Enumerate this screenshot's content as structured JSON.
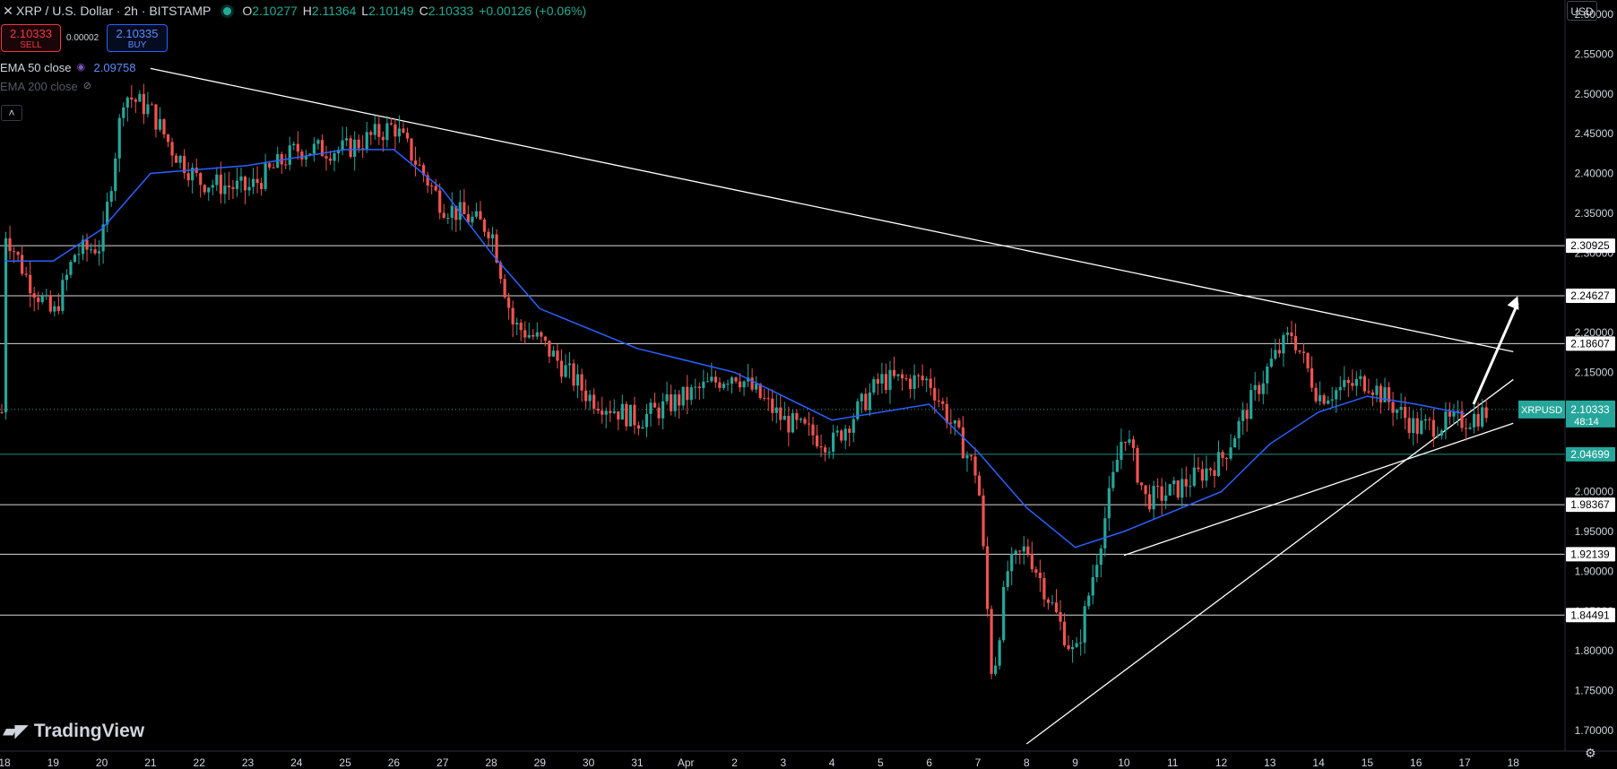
{
  "header": {
    "symbol_text": "XRP / U.S. Dollar · 2h · BITSTAMP",
    "open_label": "O",
    "open": "2.10277",
    "high_label": "H",
    "high": "2.11364",
    "low_label": "L",
    "low": "2.10149",
    "close_label": "C",
    "close": "2.10333",
    "change": "+0.00126 (+0.06%)"
  },
  "trade": {
    "sell_price": "2.10333",
    "sell_label": "SELL",
    "buy_price": "2.10335",
    "buy_label": "BUY",
    "spread": "0.00002"
  },
  "indicators": [
    {
      "label": "EMA 50 close",
      "value": "2.09758"
    },
    {
      "label": "EMA 200 close",
      "value": ""
    }
  ],
  "currency": "USD",
  "logo_text": "TradingView",
  "colors": {
    "up": "#26a69a",
    "down": "#ef5350",
    "ema50": "#2962ff",
    "background": "#000000",
    "support_line": "#ffffff",
    "current_price": "#26a69a"
  },
  "chart_data": {
    "type": "candlestick",
    "y_axis_ticks": [
      "2.60000",
      "2.55000",
      "2.50000",
      "2.45000",
      "2.40000",
      "2.35000",
      "2.30000",
      "2.25000",
      "2.20000",
      "2.15000",
      "2.10000",
      "2.05000",
      "2.00000",
      "1.95000",
      "1.90000",
      "1.85000",
      "1.80000",
      "1.75000",
      "1.70000"
    ],
    "ylim": [
      1.674,
      2.618
    ],
    "x_axis_ticks": [
      "18",
      "19",
      "20",
      "21",
      "22",
      "23",
      "24",
      "25",
      "26",
      "27",
      "28",
      "29",
      "30",
      "31",
      "Apr",
      "2",
      "3",
      "4",
      "5",
      "6",
      "7",
      "8",
      "9",
      "10",
      "11",
      "12",
      "13",
      "14",
      "15",
      "16",
      "17",
      "18"
    ],
    "horizontal_levels": [
      {
        "value": 2.30925,
        "label": "2.30925"
      },
      {
        "value": 2.24627,
        "label": "2.24627"
      },
      {
        "value": 2.18607,
        "label": "2.18607"
      },
      {
        "value": 2.04699,
        "label": "2.04699",
        "color": "#26a69a"
      },
      {
        "value": 1.98367,
        "label": "1.98367"
      },
      {
        "value": 1.92139,
        "label": "1.92139"
      },
      {
        "value": 1.84491,
        "label": "1.84491"
      }
    ],
    "current_price": {
      "symbol": "XRPUSD",
      "value": 2.10333,
      "label": "2.10333",
      "countdown": "48:14"
    },
    "trendlines": [
      {
        "from": [
          "Mar 21",
          2.532
        ],
        "to": [
          "Apr 18",
          2.176
        ],
        "note": "descending resistance"
      },
      {
        "from": [
          "Apr 8",
          1.683
        ],
        "to": [
          "Apr 18",
          2.141
        ],
        "note": "ascending support"
      },
      {
        "from": [
          "Apr 10",
          1.92
        ],
        "to": [
          "Apr 18",
          2.086
        ],
        "note": "ascending support"
      }
    ],
    "arrow": {
      "from": [
        "Apr 17",
        2.11
      ],
      "to": [
        "Apr 18",
        2.246
      ]
    },
    "price_path": [
      [
        "Mar 18",
        2.33
      ],
      [
        "Mar 18",
        2.27
      ],
      [
        "Mar 19",
        2.22
      ],
      [
        "Mar 19",
        2.3
      ],
      [
        "Mar 20",
        2.31
      ],
      [
        "Mar 20",
        2.5
      ],
      [
        "Mar 21",
        2.48
      ],
      [
        "Mar 21",
        2.43
      ],
      [
        "Mar 22",
        2.39
      ],
      [
        "Mar 23",
        2.38
      ],
      [
        "Mar 24",
        2.43
      ],
      [
        "Mar 25",
        2.43
      ],
      [
        "Mar 26",
        2.46
      ],
      [
        "Mar 27",
        2.36
      ],
      [
        "Mar 28",
        2.33
      ],
      [
        "Mar 28",
        2.21
      ],
      [
        "Mar 29",
        2.19
      ],
      [
        "Mar 30",
        2.12
      ],
      [
        "Mar 31",
        2.09
      ],
      [
        "Apr 1",
        2.12
      ],
      [
        "Apr 2",
        2.15
      ],
      [
        "Apr 3",
        2.09
      ],
      [
        "Apr 4",
        2.06
      ],
      [
        "Apr 5",
        2.14
      ],
      [
        "Apr 6",
        2.14
      ],
      [
        "Apr 7",
        2.02
      ],
      [
        "Apr 7",
        1.76
      ],
      [
        "Apr 7",
        1.9
      ],
      [
        "Apr 8",
        1.93
      ],
      [
        "Apr 9",
        1.79
      ],
      [
        "Apr 10",
        2.08
      ],
      [
        "Apr 10",
        1.99
      ],
      [
        "Apr 11",
        2.0
      ],
      [
        "Apr 12",
        2.04
      ],
      [
        "Apr 13",
        2.16
      ],
      [
        "Apr 13",
        2.2
      ],
      [
        "Apr 14",
        2.12
      ],
      [
        "Apr 15",
        2.14
      ],
      [
        "Apr 16",
        2.08
      ],
      [
        "Apr 17",
        2.09
      ],
      [
        "Apr 17",
        2.1
      ]
    ],
    "ema50_path": [
      [
        "Mar 18",
        2.29
      ],
      [
        "Mar 19",
        2.29
      ],
      [
        "Mar 20",
        2.33
      ],
      [
        "Mar 21",
        2.4
      ],
      [
        "Mar 23",
        2.41
      ],
      [
        "Mar 25",
        2.43
      ],
      [
        "Mar 26",
        2.43
      ],
      [
        "Mar 27",
        2.38
      ],
      [
        "Mar 28",
        2.3
      ],
      [
        "Mar 29",
        2.23
      ],
      [
        "Mar 31",
        2.18
      ],
      [
        "Apr 2",
        2.15
      ],
      [
        "Apr 4",
        2.09
      ],
      [
        "Apr 6",
        2.11
      ],
      [
        "Apr 7",
        2.05
      ],
      [
        "Apr 8",
        1.98
      ],
      [
        "Apr 9",
        1.93
      ],
      [
        "Apr 10",
        1.95
      ],
      [
        "Apr 12",
        2.0
      ],
      [
        "Apr 13",
        2.06
      ],
      [
        "Apr 14",
        2.1
      ],
      [
        "Apr 15",
        2.12
      ],
      [
        "Apr 16",
        2.11
      ],
      [
        "Apr 17",
        2.098
      ]
    ]
  }
}
